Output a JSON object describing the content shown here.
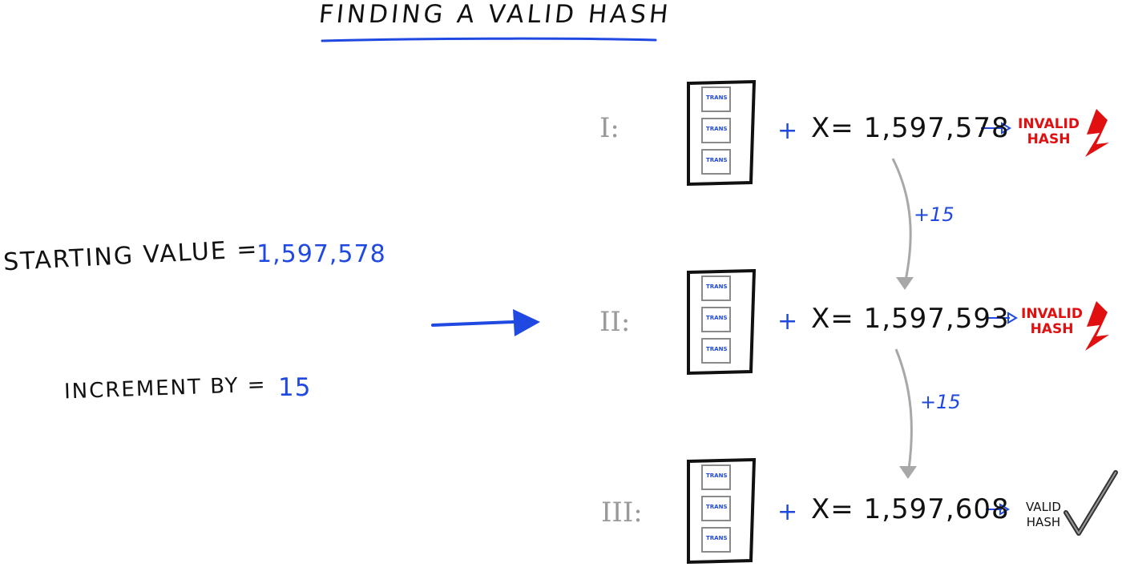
{
  "title": "FINDING  A VALID HASH",
  "left": {
    "starting_label": "STARTING  VALUE =",
    "starting_value": "1,597,578",
    "increment_label": "INCREMENT  BY =",
    "increment_value": "15"
  },
  "rows": [
    {
      "roman": "I:",
      "x_label": "X= 1,597,578",
      "status_line1": "INVALID",
      "status_line2": "HASH",
      "status": "invalid"
    },
    {
      "roman": "II:",
      "x_label": "X= 1,597,593",
      "status_line1": "INVALID",
      "status_line2": "HASH",
      "status": "invalid"
    },
    {
      "roman": "III:",
      "x_label": "X= 1,597,608",
      "status_line1": "VALID",
      "status_line2": "HASH",
      "status": "valid"
    }
  ],
  "plus_sign": "+",
  "increments": [
    "+15",
    "+15"
  ],
  "tx_label": "TRANS",
  "colors": {
    "blue": "#1f49e0",
    "red": "#e01010",
    "gray": "#9a9a9a",
    "ink": "#111111"
  }
}
